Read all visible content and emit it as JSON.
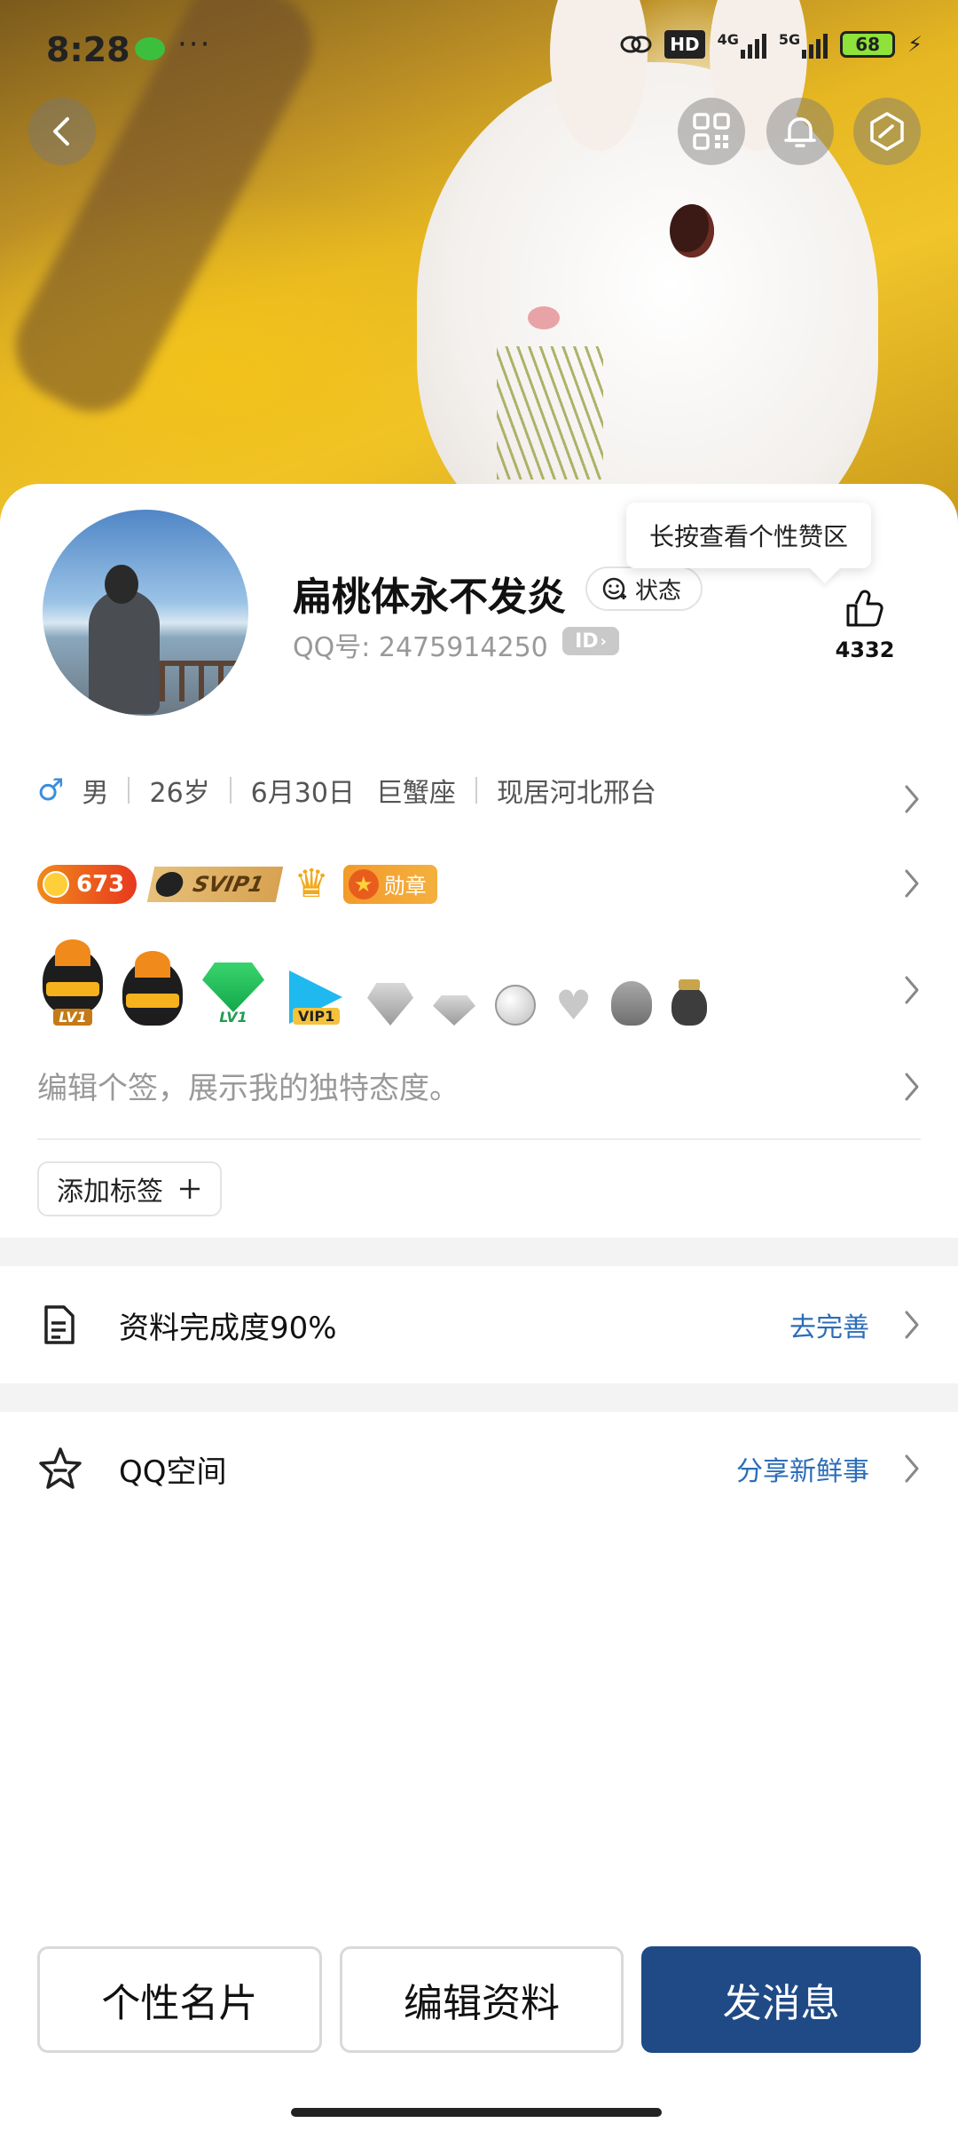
{
  "status_bar": {
    "time": "8:28",
    "more": "···",
    "hd": "HD",
    "net1": "4G",
    "net2": "5G",
    "battery": "68"
  },
  "header": {
    "tooltip": "长按查看个性赞区"
  },
  "profile": {
    "nickname": "扁桃体永不发炎",
    "status_label": "状态",
    "qq_number": "QQ号: 2475914250",
    "id_badge": "ID",
    "like_count": "4332",
    "gender_symbol": "♂",
    "gender": "男",
    "age": "26岁",
    "birthday": "6月30日",
    "zodiac": "巨蟹座",
    "location": "现居河北邢台"
  },
  "badges": {
    "coin_count": "673",
    "svip": "SVIP1",
    "medal": "勋章",
    "lv1": "LV1",
    "lv1_green": "LV1",
    "vip1": "VIP1"
  },
  "signature_placeholder": "编辑个签，展示我的独特态度。",
  "add_tag": "添加标签",
  "list": {
    "profile_completion": {
      "label": "资料完成度90%",
      "action": "去完善"
    },
    "qzone": {
      "label": "QQ空间",
      "action": "分享新鲜事"
    }
  },
  "bottom": {
    "card": "个性名片",
    "edit": "编辑资料",
    "message": "发消息"
  },
  "colors": {
    "primary": "#1f4a86",
    "link": "#2c6db8",
    "male": "#3a8de0"
  }
}
